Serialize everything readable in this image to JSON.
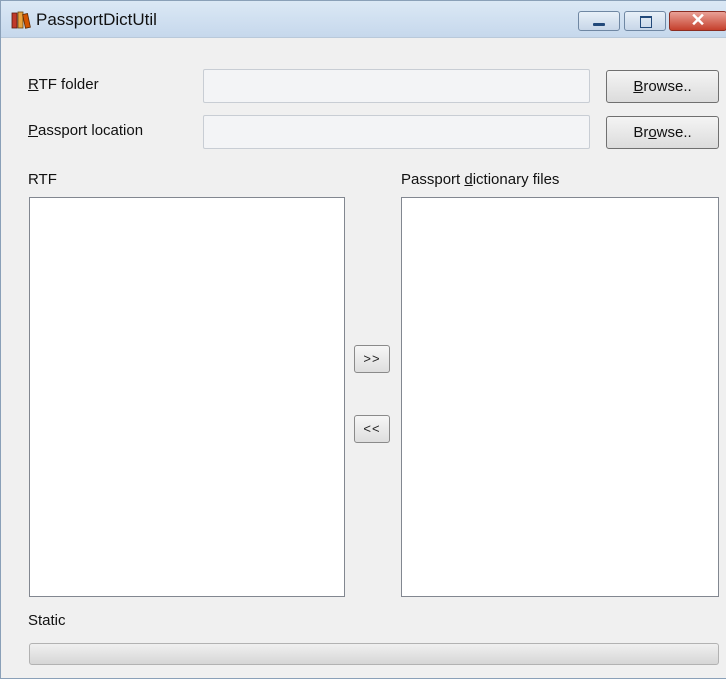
{
  "window": {
    "title": "PassportDictUtil",
    "app_icon": "books-icon"
  },
  "title_buttons": {
    "minimize": "minimize-icon",
    "maximize": "maximize-icon",
    "close": "close-icon"
  },
  "rtf_folder": {
    "label_pre": "",
    "label_key": "R",
    "label_post": "TF folder",
    "value": "",
    "browse_pre": "",
    "browse_key": "B",
    "browse_post": "rowse.."
  },
  "passport_location": {
    "label_pre": "",
    "label_key": "P",
    "label_post": "assport location",
    "value": "",
    "browse_pre": "Br",
    "browse_key": "o",
    "browse_post": "wse.."
  },
  "rtf_list": {
    "label": "RTF",
    "items": []
  },
  "passport_list": {
    "label_pre": "Passport ",
    "label_key": "d",
    "label_post": "ictionary files",
    "items": []
  },
  "move_right_label": ">>",
  "move_left_label": "<<",
  "status_text": "Static",
  "progress": 0
}
